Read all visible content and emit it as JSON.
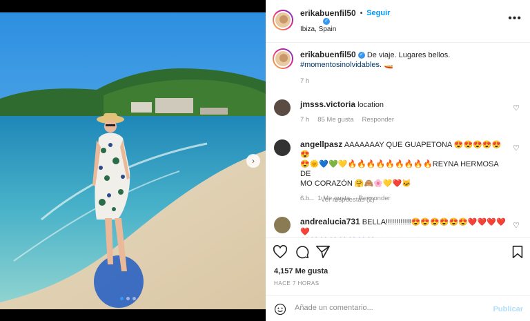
{
  "post": {
    "author": "erikabuenfil50",
    "follow_label": "Seguir",
    "location": "Ibiza, Spain",
    "caption_text": "De viaje. Lugares bellos.",
    "caption_hashtag": "#momentosinolvidables.",
    "caption_emoji": "🚤",
    "caption_time": "7 h",
    "likes": "4,157 Me gusta",
    "posted": "HACE 7 HORAS",
    "carousel": {
      "count": 3,
      "current": 1
    }
  },
  "comments": [
    {
      "user": "jmsss.victoria",
      "text": "location",
      "time": "7 h",
      "likes": "85 Me gusta",
      "reply": "Responder"
    },
    {
      "user": "angellpasz",
      "text": "AAAAAAAY QUE GUAPETONA 😍😍😍😍😍😍",
      "text2": "😍🌞💙💚💛🔥🔥🔥🔥🔥🔥🔥🔥🔥REYNA HERMOSA DE",
      "text3": "MO CORAZÓN 🤗🙈🌸💛❤️🐱",
      "time": "6 h",
      "likes": "1 Me gusta",
      "reply": "Responder",
      "view_replies": "Ver respuestas (2)"
    },
    {
      "user": "andrealucia731",
      "text": "BELLA!!!!!!!!!!!!😍😍😍😍😍😍❤️❤️❤️❤️❤️",
      "text2": "❤️💙💙💙💙💙💙💙✨✨✨✨✨🚤🚤🚤🙈🙈"
    }
  ],
  "comment_box": {
    "placeholder": "Añade un comentario...",
    "publish": "Publicar"
  }
}
